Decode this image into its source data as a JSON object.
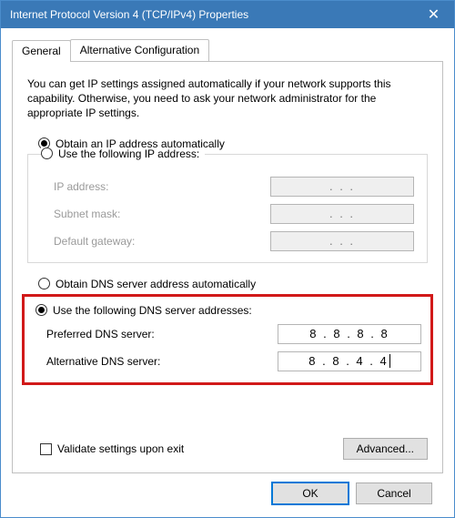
{
  "title": "Internet Protocol Version 4 (TCP/IPv4) Properties",
  "tabs": {
    "general": "General",
    "alt": "Alternative Configuration"
  },
  "intro": "You can get IP settings assigned automatically if your network supports this capability. Otherwise, you need to ask your network administrator for the appropriate IP settings.",
  "ip": {
    "auto": "Obtain an IP address automatically",
    "manual": "Use the following IP address:",
    "addr_label": "IP address:",
    "mask_label": "Subnet mask:",
    "gw_label": "Default gateway:",
    "addr": ".     .     .",
    "mask": ".     .     .",
    "gw": ".     .     ."
  },
  "dns": {
    "auto": "Obtain DNS server address automatically",
    "manual": "Use the following DNS server addresses:",
    "pref_label": "Preferred DNS server:",
    "alt_label": "Alternative DNS server:",
    "pref": "8 . 8 . 8 . 8",
    "alt": "8 . 8 . 4 . 4"
  },
  "validate": "Validate settings upon exit",
  "buttons": {
    "advanced": "Advanced...",
    "ok": "OK",
    "cancel": "Cancel"
  }
}
